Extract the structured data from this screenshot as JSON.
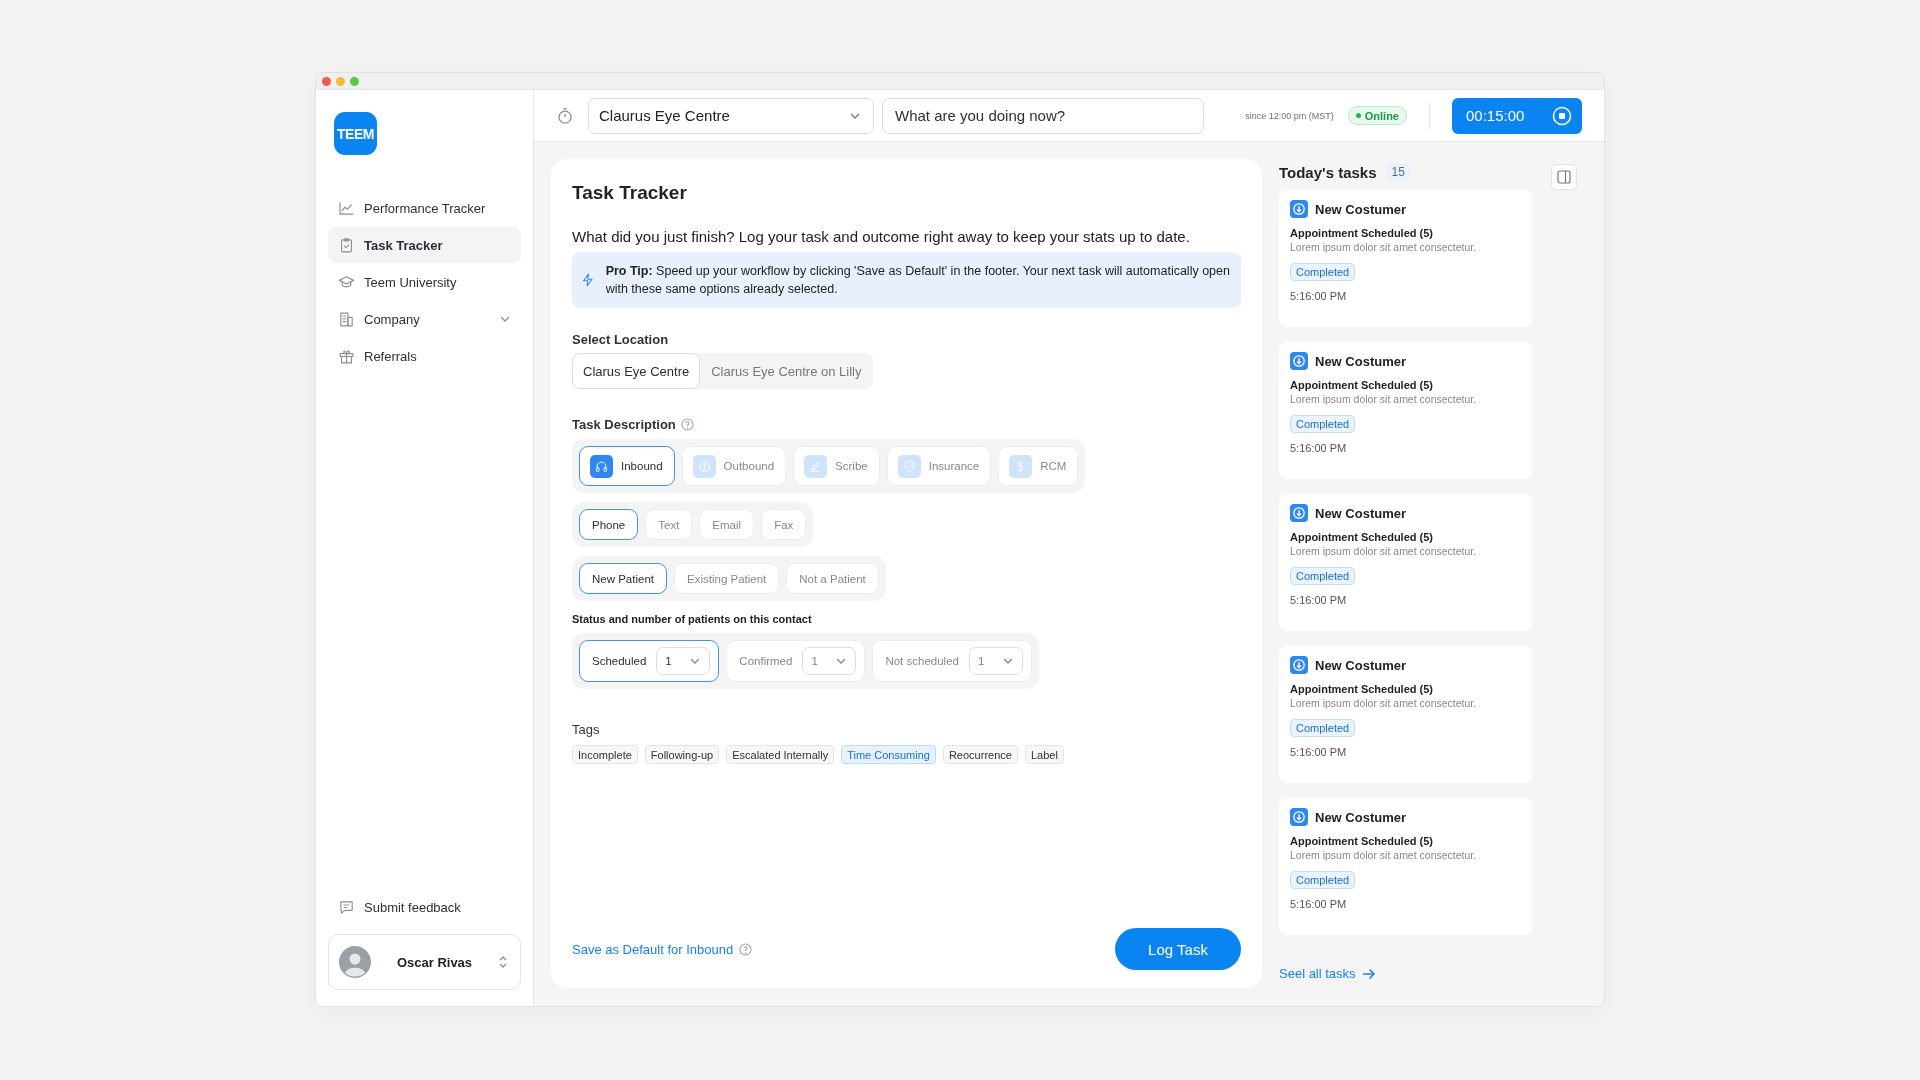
{
  "sidebar": {
    "logo": "TEEM",
    "nav": [
      {
        "label": "Performance Tracker",
        "kind": "chart",
        "selected": false,
        "has_submenu": false
      },
      {
        "label": "Task Tracker",
        "kind": "clipboard",
        "selected": true,
        "has_submenu": false
      },
      {
        "label": "Teem University",
        "kind": "graduation",
        "selected": false,
        "has_submenu": false
      },
      {
        "label": "Company",
        "kind": "building",
        "selected": false,
        "has_submenu": true
      },
      {
        "label": "Referrals",
        "kind": "gift",
        "selected": false,
        "has_submenu": false
      }
    ],
    "feedback": "Submit feedback",
    "user": {
      "name": "Oscar Rivas"
    }
  },
  "topbar": {
    "location": "Claurus Eye Centre",
    "activity": {
      "placeholder": "What are you doing now?"
    },
    "since": "since 12:00 pm (MST)",
    "status": "Online",
    "timer": "00:15:00"
  },
  "main": {
    "title": "Task Tracker",
    "intro": "What did you just finish? Log your task and outcome right away to keep your stats up to date.",
    "tip": "**Pro Tip:** Speed up your workflow by clicking 'Save as Default' in the footer. Your next task will automatically open with these same options already selected.",
    "location": {
      "label": "Select Location",
      "options": [
        {
          "label": "Clarus Eye Centre",
          "selected": true
        },
        {
          "label": "Clarus Eye Centre on Lilly",
          "selected": false
        }
      ]
    },
    "task_description": {
      "label": "Task Description",
      "types": [
        {
          "label": "Inbound",
          "kind": "headphones",
          "selected": true
        },
        {
          "label": "Outbound",
          "kind": "upload",
          "selected": false
        },
        {
          "label": "Scribe",
          "kind": "pen",
          "selected": false
        },
        {
          "label": "Insurance",
          "kind": "shield",
          "selected": false
        },
        {
          "label": "RCM",
          "kind": "dollar",
          "selected": false
        }
      ],
      "channels": [
        {
          "label": "Phone",
          "selected": true
        },
        {
          "label": "Text",
          "selected": false
        },
        {
          "label": "Email",
          "selected": false
        },
        {
          "label": "Fax",
          "selected": false
        }
      ],
      "patients": [
        {
          "label": "New Patient",
          "selected": true
        },
        {
          "label": "Existing Patient",
          "selected": false
        },
        {
          "label": "Not a Patient",
          "selected": false
        }
      ]
    },
    "status_label": "Status and number of patients on this contact",
    "statuses": [
      {
        "label": "Scheduled",
        "value": "1",
        "selected": true
      },
      {
        "label": "Confirmed",
        "value": "1",
        "selected": false
      },
      {
        "label": "Not scheduled",
        "value": "1",
        "selected": false
      }
    ],
    "tags_label": "Tags",
    "tags": [
      {
        "label": "Incomplete",
        "selected": false
      },
      {
        "label": "Following-up",
        "selected": false
      },
      {
        "label": "Escalated Internally",
        "selected": false
      },
      {
        "label": "Time Consuming",
        "selected": true
      },
      {
        "label": "Reocurrence",
        "selected": false
      },
      {
        "label": "Label",
        "selected": false
      }
    ],
    "save_default": "Save as Default for Inbound",
    "log_button": "Log Task"
  },
  "tasks": {
    "title": "Today's tasks",
    "count": "15",
    "items": [
      {
        "title": "New Costumer",
        "subtitle": "Appointment Scheduled (5)",
        "description": "Lorem ipsum dolor sit amet consectetur.",
        "status": "Completed",
        "time": "5:16:00 PM"
      },
      {
        "title": "New Costumer",
        "subtitle": "Appointment Scheduled (5)",
        "description": "Lorem ipsum dolor sit amet consectetur.",
        "status": "Completed",
        "time": "5:16:00 PM"
      },
      {
        "title": "New Costumer",
        "subtitle": "Appointment Scheduled (5)",
        "description": "Lorem ipsum dolor sit amet consectetur.",
        "status": "Completed",
        "time": "5:16:00 PM"
      },
      {
        "title": "New Costumer",
        "subtitle": "Appointment Scheduled (5)",
        "description": "Lorem ipsum dolor sit amet consectetur.",
        "status": "Completed",
        "time": "5:16:00 PM"
      },
      {
        "title": "New Costumer",
        "subtitle": "Appointment Scheduled (5)",
        "description": "Lorem ipsum dolor sit amet consectetur.",
        "status": "Completed",
        "time": "5:16:00 PM"
      }
    ],
    "see_all": "Seel all tasks"
  }
}
